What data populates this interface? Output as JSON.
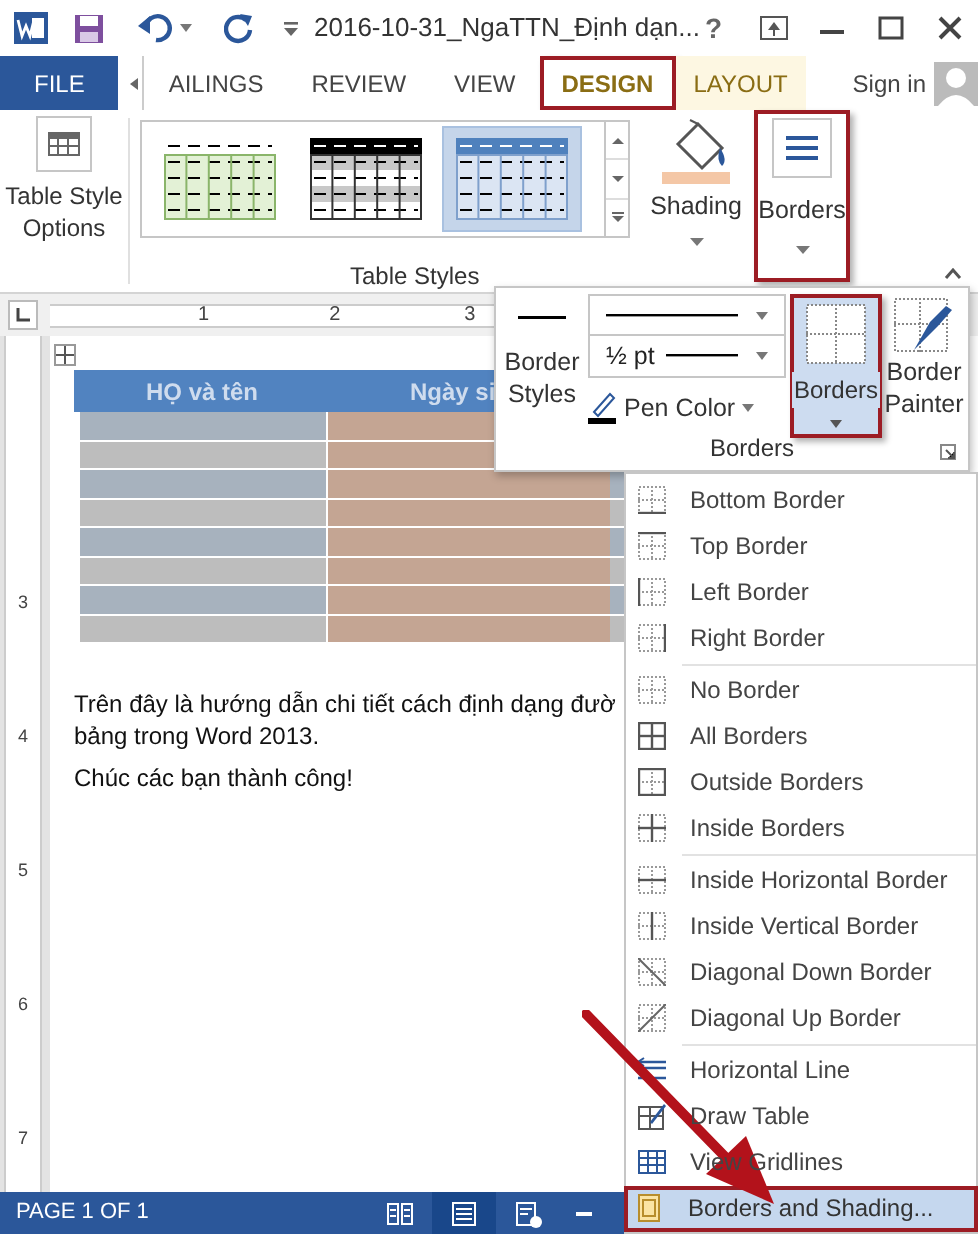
{
  "title_bar": {
    "title": "2016-10-31_NgaTTN_Định dạn...",
    "help": "?"
  },
  "tabs": [
    {
      "label": "FILE",
      "kind": "file",
      "selected": false,
      "highlighted": false
    },
    {
      "label": "AILINGS",
      "kind": "tab",
      "selected": false,
      "highlighted": false
    },
    {
      "label": "REVIEW",
      "kind": "tab",
      "selected": false,
      "highlighted": false
    },
    {
      "label": "VIEW",
      "kind": "tab",
      "selected": false,
      "highlighted": false
    },
    {
      "label": "DESIGN",
      "kind": "contextual",
      "selected": true,
      "highlighted": true
    },
    {
      "label": "LAYOUT",
      "kind": "contextual",
      "selected": false,
      "highlighted": false
    }
  ],
  "sign_in": "Sign in",
  "ribbon": {
    "table_style_options": "Table Style Options",
    "table_styles": [
      {
        "kind": "green",
        "selected": false
      },
      {
        "kind": "dark",
        "selected": false
      },
      {
        "kind": "blue",
        "selected": true
      }
    ],
    "shading": "Shading",
    "borders": {
      "label": "Borders",
      "highlighted": true
    },
    "group_label": "Table Styles"
  },
  "ruler": {
    "h_numbers": [
      "1",
      "2",
      "3"
    ],
    "v_numbers": [
      "3",
      "4",
      "5",
      "6",
      "7"
    ]
  },
  "document": {
    "table": {
      "columns": [
        "HỌ và tên",
        "Ngày si"
      ]
    },
    "paragraphs": [
      [
        "Trên đây là hướng dẫn chi tiết cách định dạng đườ",
        "bảng trong Word 2013."
      ],
      [
        "Chúc các bạn thành công!"
      ]
    ]
  },
  "borders_panel": {
    "border_styles": "Border Styles",
    "line_weight": "½ pt",
    "pen_color": "Pen Color",
    "borders_button": {
      "label": "Borders",
      "highlighted": true
    },
    "border_painter": "Border Painter",
    "group_label": "Borders"
  },
  "borders_menu": {
    "groups": [
      {
        "items": [
          {
            "label": "Bottom Border",
            "kind": "bottom",
            "selected": false,
            "highlighted": false
          },
          {
            "label": "Top Border",
            "kind": "top",
            "selected": false,
            "highlighted": false
          },
          {
            "label": "Left Border",
            "kind": "left",
            "selected": false,
            "highlighted": false
          },
          {
            "label": "Right Border",
            "kind": "right",
            "selected": false,
            "highlighted": false
          }
        ]
      },
      {
        "items": [
          {
            "label": "No Border",
            "kind": "none",
            "selected": false,
            "highlighted": false
          },
          {
            "label": "All Borders",
            "kind": "all",
            "selected": false,
            "highlighted": false
          },
          {
            "label": "Outside Borders",
            "kind": "outside",
            "selected": false,
            "highlighted": false
          },
          {
            "label": "Inside Borders",
            "kind": "inside",
            "selected": false,
            "highlighted": false
          }
        ]
      },
      {
        "items": [
          {
            "label": "Inside Horizontal Border",
            "kind": "inside_h",
            "selected": false,
            "highlighted": false
          },
          {
            "label": "Inside Vertical Border",
            "kind": "inside_v",
            "selected": false,
            "highlighted": false
          },
          {
            "label": "Diagonal Down Border",
            "kind": "diag_down",
            "selected": false,
            "highlighted": false
          },
          {
            "label": "Diagonal Up Border",
            "kind": "diag_up",
            "selected": false,
            "highlighted": false
          }
        ]
      },
      {
        "items": [
          {
            "label": "Horizontal Line",
            "kind": "hline",
            "selected": false,
            "highlighted": false
          },
          {
            "label": "Draw Table",
            "kind": "draw_table",
            "selected": false,
            "highlighted": false
          },
          {
            "label": "View Gridlines",
            "kind": "gridlines",
            "selected": false,
            "highlighted": false
          },
          {
            "label": "Borders and Shading...",
            "kind": "dialog",
            "selected": true,
            "highlighted": true
          }
        ]
      }
    ]
  },
  "status_bar": {
    "page": "PAGE 1 OF 1",
    "views": [
      {
        "kind": "read",
        "selected": false
      },
      {
        "kind": "print",
        "selected": true
      },
      {
        "kind": "web",
        "selected": false
      }
    ]
  }
}
